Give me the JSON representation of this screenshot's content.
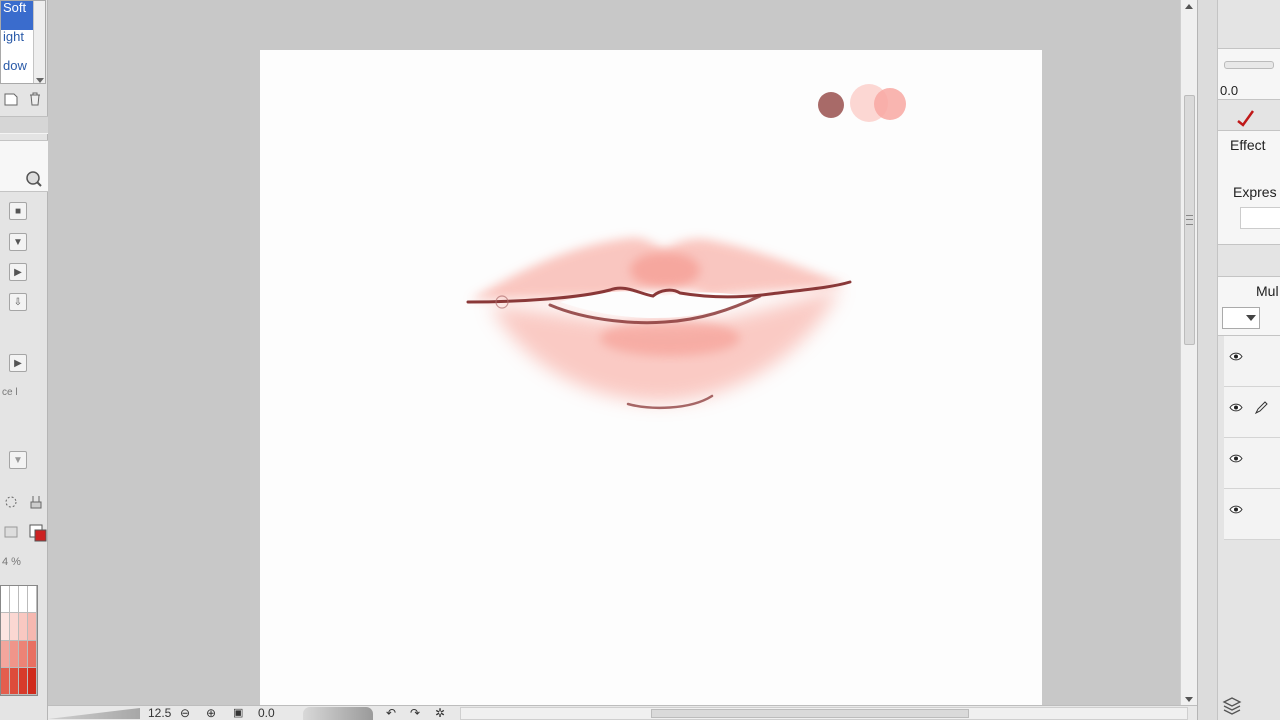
{
  "left_panel": {
    "blend_list": [
      {
        "label": "Soft",
        "selected": true
      },
      {
        "label": "ight",
        "selected": false
      },
      {
        "label": "dow",
        "selected": false
      }
    ],
    "icons": [
      "new-layer-icon",
      "trash-icon",
      "magnifier-icon",
      "transform-icon",
      "tool-gear-icon"
    ],
    "percent_label": "4 %",
    "face_label": "ce l",
    "palette_colors": [
      "#ffffff",
      "#ffffff",
      "#ffffff",
      "#ffffff",
      "#fde5e1",
      "#fbd7d2",
      "#f9c8c1",
      "#f6b8b0",
      "#f3a69d",
      "#f0958a",
      "#ec8376",
      "#e87062",
      "#e35e4e",
      "#dd4c3b",
      "#d73a2a",
      "#d02b1c"
    ]
  },
  "canvas": {
    "swatches": [
      {
        "name": "dark-rose",
        "color": "#a86a68"
      },
      {
        "name": "light-pink",
        "color": "#fbd0cb"
      },
      {
        "name": "salmon-pink",
        "color": "#f8a8a2"
      }
    ],
    "lip_colors": {
      "base": "#f9b9b1",
      "mid": "#f59a90",
      "line": "#8a3838",
      "highlight": "#fdfdfd"
    }
  },
  "status_bar": {
    "zoom": "12.5",
    "rotation": "0.0",
    "icons": [
      "zoom-out-icon",
      "zoom-in-icon",
      "fit-icon",
      "rotate-left-icon",
      "rotate-right-icon",
      "reset-rotation-icon"
    ]
  },
  "right_panel": {
    "slider_value": "0.0",
    "effect_label": "Effect",
    "expression_label": "Expres",
    "blend_mode": "Mul",
    "layer_count": 4
  }
}
